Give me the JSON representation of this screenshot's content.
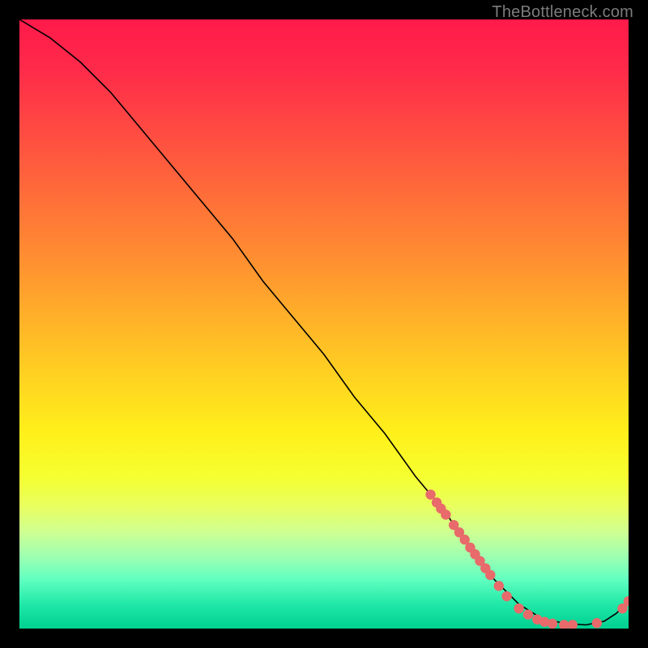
{
  "watermark": "TheBottleneck.com",
  "chart_data": {
    "type": "line",
    "title": "",
    "xlabel": "",
    "ylabel": "",
    "xlim": [
      0,
      100
    ],
    "ylim": [
      0,
      100
    ],
    "series": [
      {
        "name": "curve",
        "x": [
          0,
          5,
          10,
          15,
          20,
          25,
          30,
          35,
          40,
          45,
          50,
          55,
          60,
          65,
          70,
          74,
          78,
          82,
          86,
          90,
          93,
          96,
          98,
          100
        ],
        "values": [
          100,
          97,
          93,
          88,
          82,
          76,
          70,
          64,
          57,
          51,
          45,
          38,
          32,
          25,
          19,
          13,
          8,
          4,
          1.5,
          0.8,
          0.6,
          1.2,
          2.5,
          4.5
        ]
      }
    ],
    "points": [
      {
        "x": 67.5,
        "y": 22.0
      },
      {
        "x": 68.5,
        "y": 20.7
      },
      {
        "x": 69.2,
        "y": 19.7
      },
      {
        "x": 70.0,
        "y": 18.7
      },
      {
        "x": 71.3,
        "y": 17.0
      },
      {
        "x": 72.2,
        "y": 15.8
      },
      {
        "x": 73.1,
        "y": 14.6
      },
      {
        "x": 74.0,
        "y": 13.3
      },
      {
        "x": 74.8,
        "y": 12.2
      },
      {
        "x": 75.6,
        "y": 11.1
      },
      {
        "x": 76.5,
        "y": 9.9
      },
      {
        "x": 77.3,
        "y": 8.8
      },
      {
        "x": 78.7,
        "y": 7.0
      },
      {
        "x": 80.0,
        "y": 5.3
      },
      {
        "x": 82.0,
        "y": 3.3
      },
      {
        "x": 83.5,
        "y": 2.3
      },
      {
        "x": 85.0,
        "y": 1.5
      },
      {
        "x": 86.2,
        "y": 1.1
      },
      {
        "x": 87.5,
        "y": 0.8
      },
      {
        "x": 89.4,
        "y": 0.6
      },
      {
        "x": 90.8,
        "y": 0.6
      },
      {
        "x": 94.8,
        "y": 0.9
      },
      {
        "x": 99.0,
        "y": 3.3
      },
      {
        "x": 100.0,
        "y": 4.5
      }
    ],
    "point_color": "#e86a6a",
    "line_color": "#000000"
  }
}
